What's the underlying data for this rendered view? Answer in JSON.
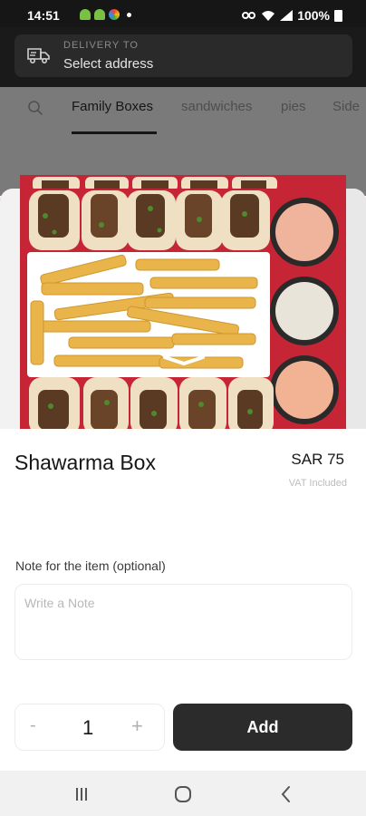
{
  "status_bar": {
    "time": "14:51",
    "battery": "100%",
    "icons": [
      "android-icon",
      "android-icon",
      "color-app-icon",
      "dot-icon",
      "vpn-key-icon",
      "wifi-icon",
      "signal-icon",
      "battery-icon"
    ]
  },
  "header": {
    "delivery_label": "DELIVERY TO",
    "delivery_value": "Select address",
    "icon": "truck-icon"
  },
  "categories": {
    "search_icon": "search-icon",
    "tabs": [
      "Family Boxes",
      "sandwiches",
      "pies",
      "Side"
    ],
    "active_index": 0
  },
  "item": {
    "image": "shawarma-box-photo",
    "title": "Shawarma Box",
    "price": "SAR 75",
    "vat_note": "VAT Included"
  },
  "note": {
    "label": "Note for the item (optional)",
    "placeholder": "Write a Note",
    "value": ""
  },
  "quantity": {
    "minus": "-",
    "value": "1",
    "plus": "+"
  },
  "actions": {
    "add_label": "Add"
  },
  "colors": {
    "header_bg": "#1a1a1a",
    "button_bg": "#2b2b2b",
    "tray_red": "#c52535"
  },
  "nav_bar": {
    "icons": [
      "recents-icon",
      "home-icon",
      "back-icon"
    ]
  }
}
